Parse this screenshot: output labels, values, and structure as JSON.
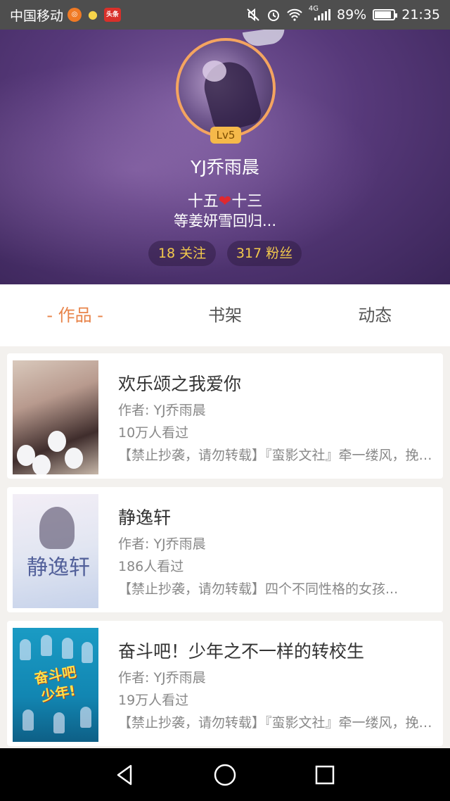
{
  "status_bar": {
    "carrier": "中国移动",
    "news_badge": "头条",
    "network": "4G",
    "battery": "89%",
    "battery_level": 0.89,
    "time": "21:35"
  },
  "profile": {
    "level": "Lv5",
    "username": "YJ乔雨晨",
    "bio_left": "十五",
    "bio_heart": "❤",
    "bio_right": "十三",
    "bio_line2": "等姜妍雪回归...",
    "following": "18 关注",
    "fans": "317 粉丝"
  },
  "tabs": [
    {
      "label": "- 作品 -",
      "active": true
    },
    {
      "label": "书架",
      "active": false
    },
    {
      "label": "动态",
      "active": false
    }
  ],
  "books": [
    {
      "title": "欢乐颂之我爱你",
      "author": "作者: YJ乔雨晨",
      "views": "10万人看过",
      "desc": "【禁止抄袭，请勿转载】『蛮影文社』牵一缕风，挽一缕云..."
    },
    {
      "title": "静逸轩",
      "author": "作者: YJ乔雨晨",
      "views": "186人看过",
      "desc": "【禁止抄袭，请勿转载】四个不同性格的女孩..."
    },
    {
      "title": "奋斗吧！少年之不一样的转校生",
      "author": "作者: YJ乔雨晨",
      "views": "19万人看过",
      "desc": "【禁止抄袭，请勿转载】『蛮影文社』牵一缕风，挽一缕云..."
    }
  ],
  "covers": {
    "cover2_text": "静逸轩",
    "cover3_text": "奋斗吧少年!"
  },
  "colors": {
    "accent": "#e8844a",
    "header_bg": "#57397a",
    "stat_text": "#f3c94c",
    "level_badge": "#f5b94a"
  },
  "icons": {
    "nav": [
      "back-triangle-icon",
      "home-circle-icon",
      "recent-square-icon"
    ]
  }
}
